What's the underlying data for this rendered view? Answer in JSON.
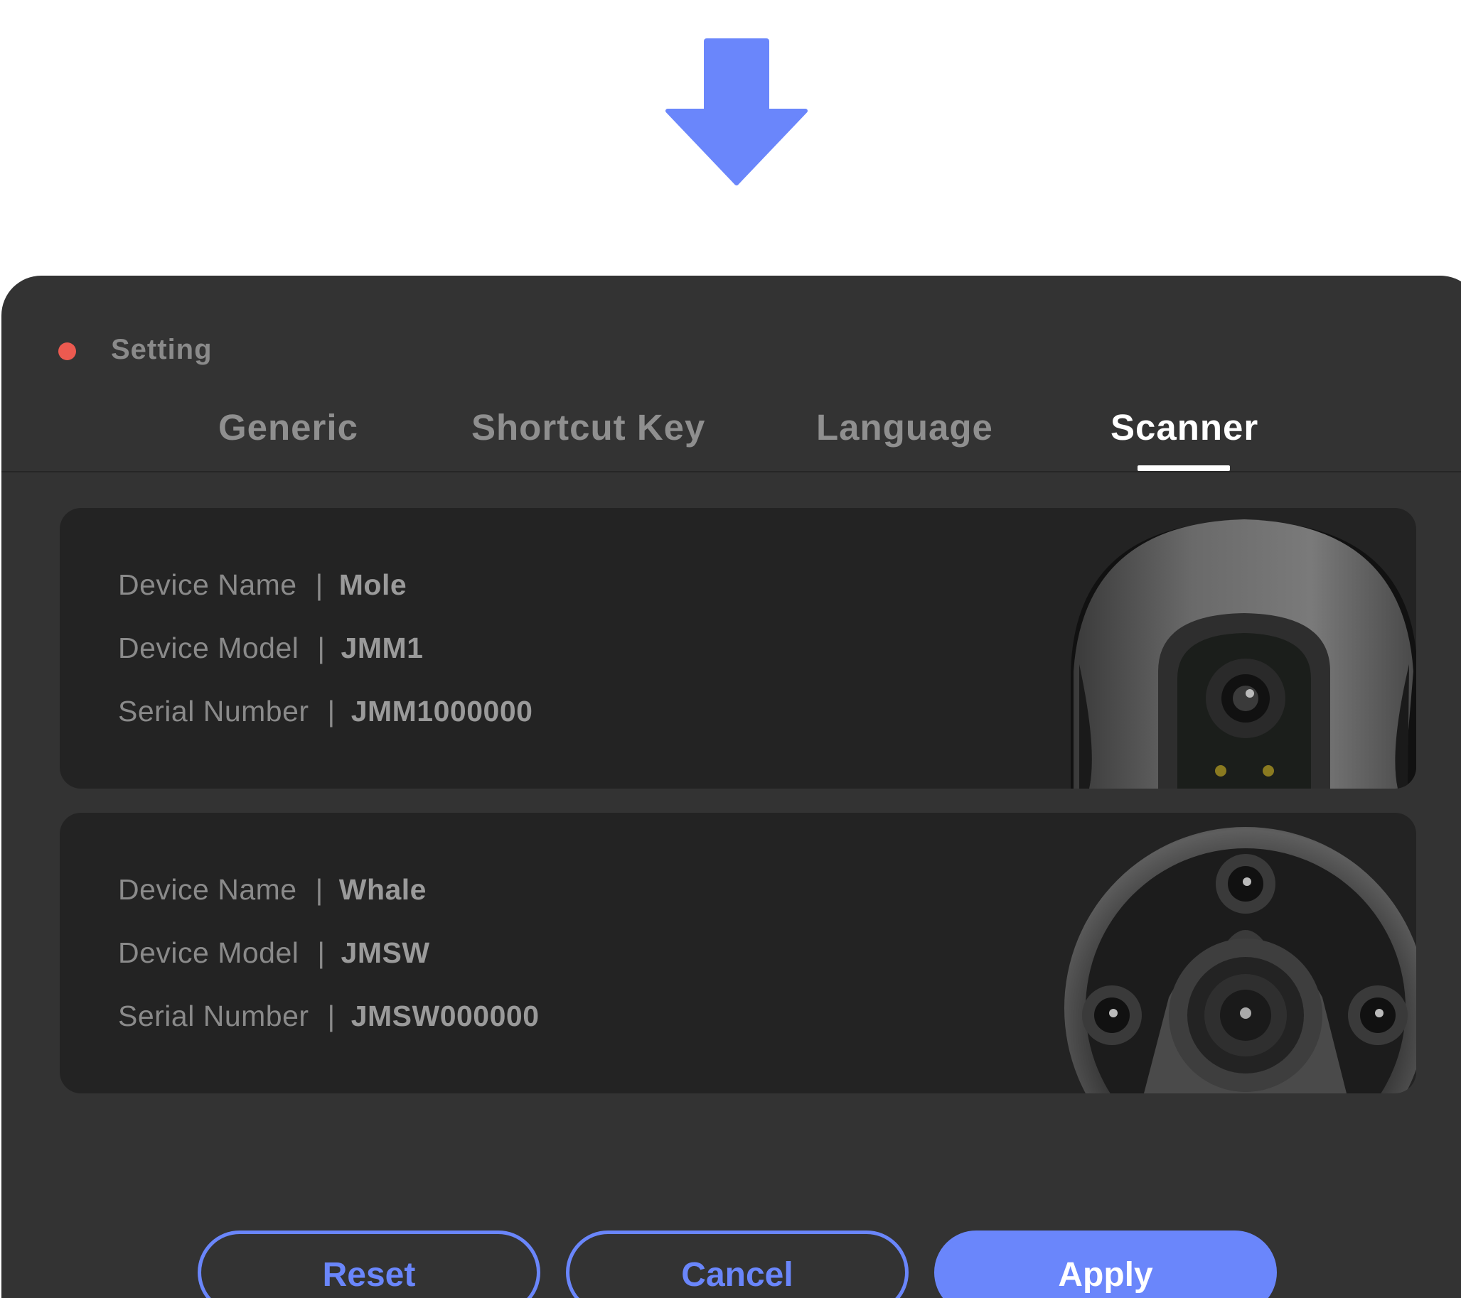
{
  "window": {
    "title": "Setting"
  },
  "tabs": [
    {
      "label": "Generic",
      "active": false
    },
    {
      "label": "Shortcut Key",
      "active": false
    },
    {
      "label": "Language",
      "active": false
    },
    {
      "label": "Scanner",
      "active": true
    }
  ],
  "fields": {
    "name_label": "Device Name",
    "model_label": "Device Model",
    "serial_label": "Serial Number",
    "separator": "|"
  },
  "devices": [
    {
      "name": "Mole",
      "model": "JMM1",
      "serial": "JMM1000000",
      "image_icon": "mole-scanner-image"
    },
    {
      "name": "Whale",
      "model": "JMSW",
      "serial": "JMSW000000",
      "image_icon": "whale-scanner-image"
    }
  ],
  "buttons": {
    "reset": "Reset",
    "cancel": "Cancel",
    "apply": "Apply"
  },
  "colors": {
    "accent": "#6a86fb",
    "window_bg": "#333333",
    "card_bg": "#232323",
    "close_dot": "#ec5a50"
  }
}
